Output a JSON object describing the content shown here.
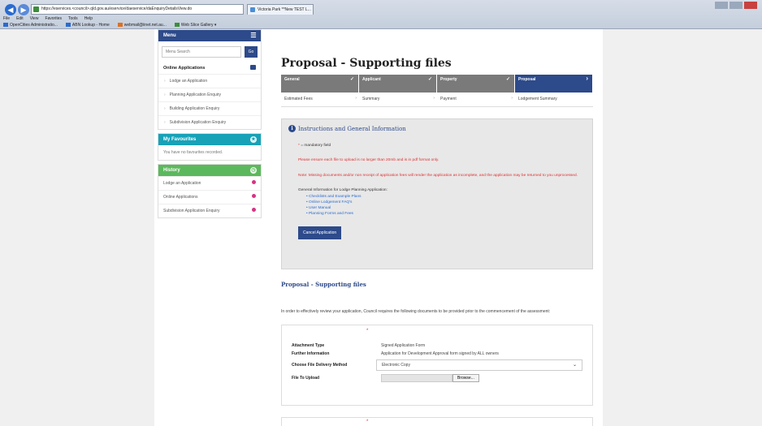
{
  "browser": {
    "address": "https://eservices.<council>.qld.gov.au/eservice/daeservice/daEnquiryDetailsView.do",
    "tab_title": "Victoria Park **New TEST L...",
    "menu": [
      "File",
      "Edit",
      "View",
      "Favorites",
      "Tools",
      "Help"
    ],
    "favorites": [
      "OpenCities Administratio...",
      "ABN Lookup - Home",
      "webmail@iinet.net.au...",
      "Web Slice Gallery ▾"
    ]
  },
  "sidebar": {
    "menu_title": "Menu",
    "search_placeholder": "Menu Search",
    "go_label": "Go",
    "online_apps_title": "Online Applications",
    "online_apps": [
      "Lodge an Application",
      "Planning Application Enquiry",
      "Building Application Enquiry",
      "Subdivision Application Enquiry"
    ],
    "favourites_title": "My Favourites",
    "favourites_empty": "You have no favourites recorded.",
    "history_title": "History",
    "history": [
      "Lodge an Application",
      "Online Applications",
      "Subdivision Application Enquiry"
    ]
  },
  "main": {
    "title": "Proposal - Supporting files",
    "steps": [
      "General",
      "Applicant",
      "Property",
      "Proposal"
    ],
    "substeps": [
      "Estimated Fees",
      "Summary",
      "Payment",
      "Lodgement Summary"
    ],
    "info": {
      "title": "Instructions and General Information",
      "mandatory_star": "*",
      "mandatory_text": " = mandatory field",
      "warning_size": "Please ensure each file to upload is no larger than 20mb and is in pdf format only.",
      "warning_missing": "Note: Missing documents and/or non receipt of application fees will render the application as incomplete, and the application may be returned to you unprocessed.",
      "general_title": "General Information for Lodge Planning Application:",
      "links": [
        "Checklists and Example Plans",
        "Online Lodgement FAQ's",
        "User Manual",
        "Planning Forms and Fees"
      ],
      "cancel_label": "Cancel Application"
    },
    "section_heading": "Proposal - Supporting files",
    "intro": "In order to effectively review your application, Council requires the following documents to be provided prior to the commencement of the assessment:",
    "attachment": {
      "star": "*",
      "type_label": "Attachment Type",
      "type_value": "Signed Application Form",
      "further_label": "Further Information",
      "further_value": "Application for Development Approval form signed by ALL owners",
      "delivery_label": "Choose File Delivery Method",
      "delivery_value": "Electronic Copy",
      "upload_label": "File To Upload",
      "browse_label": "Browse..."
    },
    "next_star": "*"
  },
  "colors": {
    "primary": "#2d4a8a",
    "favourites": "#17a2b8",
    "history": "#5cb85c",
    "warning": "#e03030",
    "step_done": "#7a7a7a"
  }
}
